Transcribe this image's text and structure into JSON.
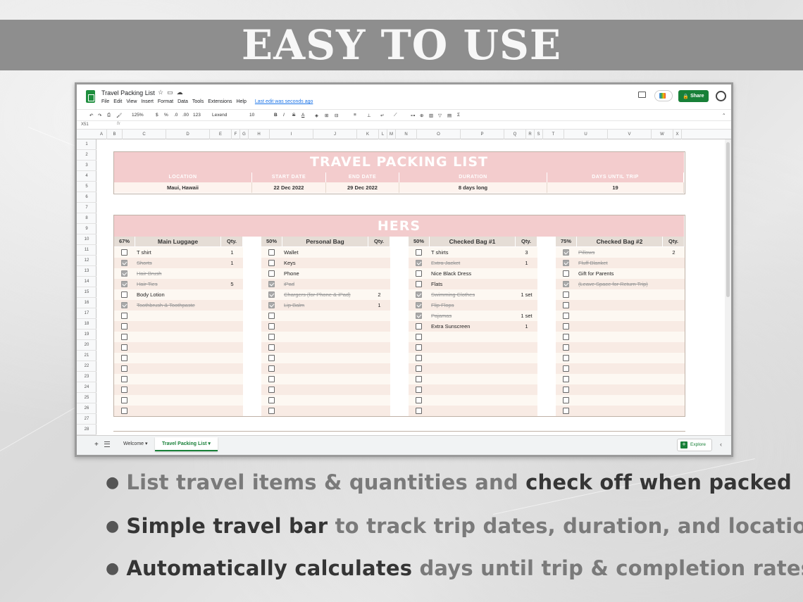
{
  "banner": {
    "title": "EASY TO USE"
  },
  "window": {
    "doc_title": "Travel Packing List",
    "menu": [
      "File",
      "Edit",
      "View",
      "Insert",
      "Format",
      "Data",
      "Tools",
      "Extensions",
      "Help"
    ],
    "last_edit": "Last edit was seconds ago",
    "share_label": "Share",
    "toolbar": {
      "zoom": "125%",
      "currency": "$",
      "percent": "%",
      "decimals_less": ".0",
      "decimals_more": ".00",
      "number_format": "123",
      "font": "Lexend",
      "font_size": "10",
      "bold": "B",
      "italic": "I",
      "strike": "S",
      "text_color": "A"
    },
    "name_box": "X51",
    "fx": "fx",
    "columns": [
      "A",
      "B",
      "C",
      "D",
      "E",
      "F",
      "G",
      "H",
      "I",
      "J",
      "K",
      "L",
      "M",
      "N",
      "O",
      "P",
      "Q",
      "R",
      "S",
      "T",
      "U",
      "V",
      "W",
      "X"
    ],
    "rows": [
      "1",
      "2",
      "3",
      "4",
      "5",
      "6",
      "7",
      "8",
      "9",
      "10",
      "11",
      "12",
      "13",
      "14",
      "15",
      "16",
      "17",
      "18",
      "19",
      "20",
      "21",
      "22",
      "23",
      "24",
      "25",
      "26",
      "27",
      "28"
    ],
    "sheet_tabs": [
      "Welcome",
      "Travel Packing List"
    ],
    "explore_label": "Explore"
  },
  "trip": {
    "title": "TRAVEL PACKING LIST",
    "headers": [
      "LOCATION",
      "START DATE",
      "END DATE",
      "DURATION",
      "DAYS UNTIL TRIP"
    ],
    "values": [
      "Maui, Hawaii",
      "22 Dec 2022",
      "29 Dec 2022",
      "8 days long",
      "19"
    ]
  },
  "hers": {
    "title": "HERS",
    "qty_label": "Qty.",
    "bags": [
      {
        "name": "Main Luggage",
        "pct": "67%",
        "items": [
          {
            "text": "T shirt",
            "qty": "1",
            "checked": false
          },
          {
            "text": "Shorts",
            "qty": "1",
            "checked": true
          },
          {
            "text": "Hair Brush",
            "qty": "",
            "checked": true
          },
          {
            "text": "Hair Ties",
            "qty": "5",
            "checked": true
          },
          {
            "text": "Body Lotion",
            "qty": "",
            "checked": false
          },
          {
            "text": "Toothbrush & Toothpaste",
            "qty": "",
            "checked": true
          }
        ]
      },
      {
        "name": "Personal Bag",
        "pct": "50%",
        "items": [
          {
            "text": "Wallet",
            "qty": "",
            "checked": false
          },
          {
            "text": "Keys",
            "qty": "",
            "checked": false
          },
          {
            "text": "Phone",
            "qty": "",
            "checked": false
          },
          {
            "text": "iPad",
            "qty": "",
            "checked": true
          },
          {
            "text": "Chargers (for Phone & iPad)",
            "qty": "2",
            "checked": true
          },
          {
            "text": "Lip Balm",
            "qty": "1",
            "checked": true
          }
        ]
      },
      {
        "name": "Checked Bag #1",
        "pct": "50%",
        "items": [
          {
            "text": "T shirts",
            "qty": "3",
            "checked": false
          },
          {
            "text": "Extra Jacket",
            "qty": "1",
            "checked": true
          },
          {
            "text": "Nice Black Dress",
            "qty": "",
            "checked": false
          },
          {
            "text": "Flats",
            "qty": "",
            "checked": false
          },
          {
            "text": "Swimming Clothes",
            "qty": "1 set",
            "checked": true
          },
          {
            "text": "Flip Flops",
            "qty": "",
            "checked": true
          },
          {
            "text": "Pajamas",
            "qty": "1 set",
            "checked": true
          },
          {
            "text": "Extra Sunscreen",
            "qty": "1",
            "checked": false
          }
        ]
      },
      {
        "name": "Checked Bag #2",
        "pct": "75%",
        "items": [
          {
            "text": "Pillows",
            "qty": "2",
            "checked": true
          },
          {
            "text": "Fluff Blanket",
            "qty": "",
            "checked": true
          },
          {
            "text": "Gift for Parents",
            "qty": "",
            "checked": false
          },
          {
            "text": "(Leave Space for Return Trip)",
            "qty": "",
            "checked": true
          }
        ]
      }
    ]
  },
  "bullets": [
    {
      "light": "List travel items & quantities and ",
      "dark": "check off when packed",
      "order": "light-first"
    },
    {
      "dark": "Simple travel bar ",
      "light": "to track trip dates, duration, and location",
      "order": "dark-first"
    },
    {
      "dark": "Automatically calculates ",
      "light": "days until trip & completion rates",
      "order": "dark-first"
    }
  ],
  "colors": {
    "banner": "#8e8e8e",
    "pink": "#f3cccd",
    "header_tan": "#e5ddd6",
    "row_light": "#fdf8f2",
    "row_dark": "#f8ebe4",
    "share_green": "#188038"
  }
}
